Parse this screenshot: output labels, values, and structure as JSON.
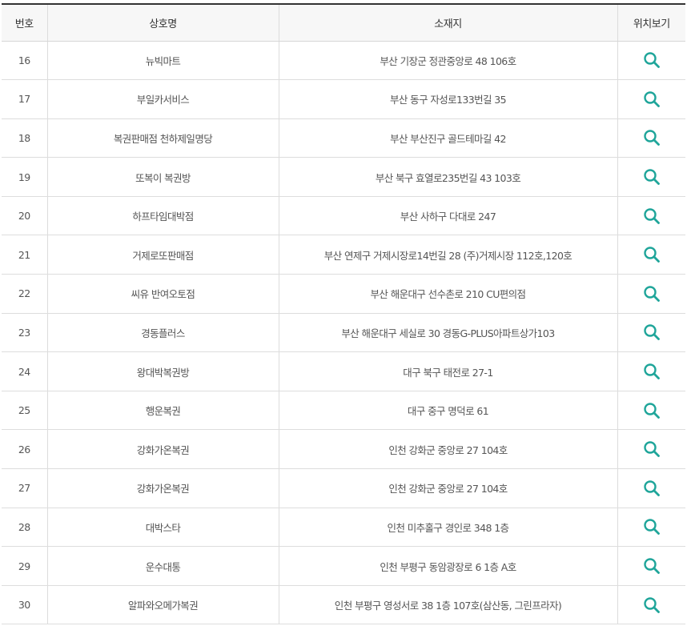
{
  "table": {
    "headers": {
      "no": "번호",
      "name": "상호명",
      "address": "소재지",
      "map": "위치보기"
    },
    "rows": [
      {
        "no": "16",
        "name": "뉴빅마트",
        "address": "부산 기장군 정관중앙로 48 106호"
      },
      {
        "no": "17",
        "name": "부일카서비스",
        "address": "부산 동구 자성로133번길 35"
      },
      {
        "no": "18",
        "name": "복권판매점 천하제일명당",
        "address": "부산 부산진구 골드테마길 42"
      },
      {
        "no": "19",
        "name": "또복이 복권방",
        "address": "부산 북구 효열로235번길 43 103호"
      },
      {
        "no": "20",
        "name": "하프타임대박점",
        "address": "부산 사하구 다대로 247"
      },
      {
        "no": "21",
        "name": "거제로또판매점",
        "address": "부산 연제구 거제시장로14번길 28 (주)거제시장 112호,120호"
      },
      {
        "no": "22",
        "name": "씨유 반여오토점",
        "address": "부산 해운대구 선수촌로 210 CU편의점"
      },
      {
        "no": "23",
        "name": "경동플러스",
        "address": "부산 해운대구 세실로 30 경동G-PLUS아파트상가103"
      },
      {
        "no": "24",
        "name": "왕대박복권방",
        "address": "대구 북구 태전로 27-1"
      },
      {
        "no": "25",
        "name": "행운복권",
        "address": "대구 중구 명덕로 61"
      },
      {
        "no": "26",
        "name": "강화가온복권",
        "address": "인천 강화군 중앙로 27 104호"
      },
      {
        "no": "27",
        "name": "강화가온복권",
        "address": "인천 강화군 중앙로 27 104호"
      },
      {
        "no": "28",
        "name": "대박스타",
        "address": "인천 미추홀구 경인로 348 1층"
      },
      {
        "no": "29",
        "name": "운수대통",
        "address": "인천 부평구 동암광장로 6 1층 A호"
      },
      {
        "no": "30",
        "name": "알파와오메가복권",
        "address": "인천 부평구 영성서로 38 1층 107호(삼산동, 그린프라자)"
      }
    ],
    "map_icon": "search-icon",
    "icon_color": "#1fa59a"
  }
}
